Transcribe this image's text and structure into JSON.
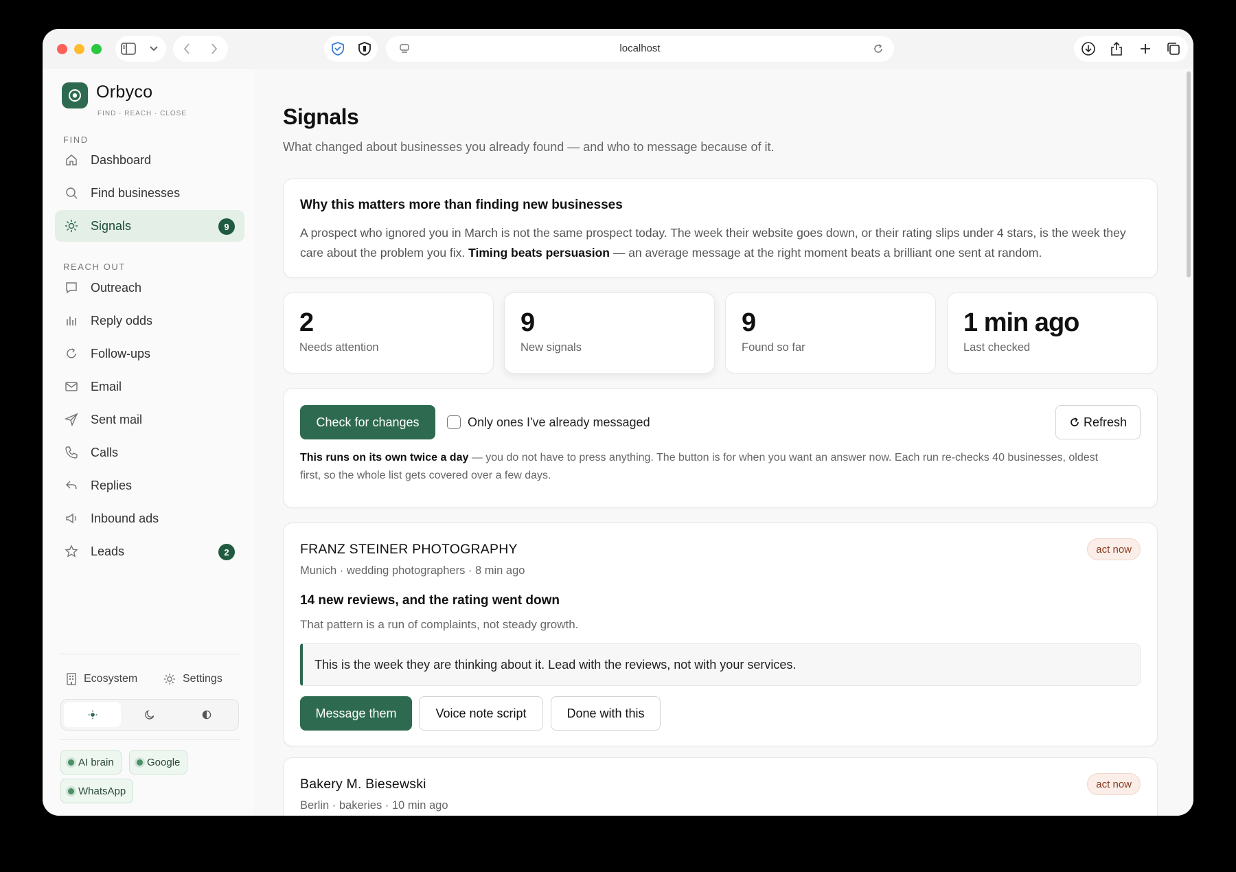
{
  "browser": {
    "url": "localhost"
  },
  "brand": {
    "name": "Orbyco",
    "tagline": "FIND · REACH · CLOSE",
    "accent": "#2d6a4f"
  },
  "sidebar": {
    "section_find": "FIND",
    "section_reach": "REACH OUT",
    "items": [
      {
        "label": "Dashboard",
        "icon": "home-icon"
      },
      {
        "label": "Find businesses",
        "icon": "search-icon"
      },
      {
        "label": "Signals",
        "icon": "sun-icon",
        "badge": "9",
        "active": true
      },
      {
        "label": "Outreach",
        "icon": "chat-icon"
      },
      {
        "label": "Reply odds",
        "icon": "bar-chart-icon"
      },
      {
        "label": "Follow-ups",
        "icon": "refresh-icon"
      },
      {
        "label": "Email",
        "icon": "mail-icon"
      },
      {
        "label": "Sent mail",
        "icon": "send-icon"
      },
      {
        "label": "Calls",
        "icon": "phone-icon"
      },
      {
        "label": "Replies",
        "icon": "reply-icon"
      },
      {
        "label": "Inbound ads",
        "icon": "megaphone-icon"
      },
      {
        "label": "Leads",
        "icon": "star-icon",
        "badge": "2"
      }
    ],
    "footer": {
      "ecosystem": "Ecosystem",
      "settings": "Settings"
    },
    "chips": [
      "AI brain",
      "Google",
      "WhatsApp"
    ]
  },
  "main": {
    "title": "Signals",
    "subtitle": "What changed about businesses you already found — and who to message because of it.",
    "why": {
      "title": "Why this matters more than finding new businesses",
      "body_1": "A prospect who ignored you in March is not the same prospect today. The week their website goes down, or their rating slips under 4 stars, is the week they care about the problem you fix. ",
      "body_bold": "Timing beats persuasion",
      "body_2": " — an average message at the right moment beats a brilliant one sent at random."
    },
    "stats": [
      {
        "value": "2",
        "label": "Needs attention"
      },
      {
        "value": "9",
        "label": "New signals"
      },
      {
        "value": "9",
        "label": "Found so far"
      },
      {
        "value": "1 min ago",
        "label": "Last checked"
      }
    ],
    "controls": {
      "check_button": "Check for changes",
      "only_messaged_label": "Only ones I've already messaged",
      "only_messaged_checked": false,
      "refresh_button": "Refresh",
      "note_bold": "This runs on its own twice a day",
      "note_rest": " — you do not have to press anything. The button is for when you want an answer now. Each run re-checks 40 businesses, oldest first, so the whole list gets covered over a few days."
    },
    "signals": [
      {
        "name": "FRANZ STEINER PHOTOGRAPHY",
        "meta": "Munich · wedding photographers · 8 min ago",
        "badge": "act now",
        "headline": "14 new reviews, and the rating went down",
        "detail": "That pattern is a run of complaints, not steady growth.",
        "advice": "This is the week they are thinking about it. Lead with the reviews, not with your services.",
        "actions": [
          "Message them",
          "Voice note script",
          "Done with this"
        ]
      },
      {
        "name": "Bakery M. Biesewski",
        "meta": "Berlin · bakeries · 10 min ago",
        "badge": "act now"
      }
    ]
  }
}
